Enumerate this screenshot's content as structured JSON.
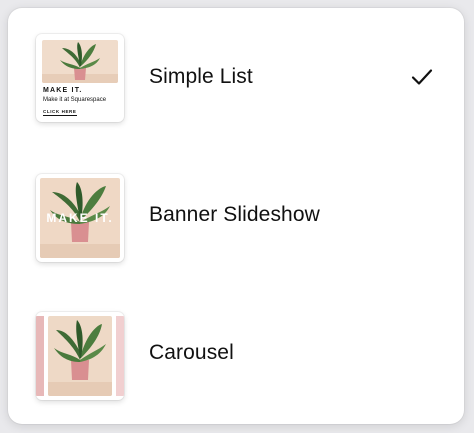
{
  "options": [
    {
      "label": "Simple List",
      "selected": true,
      "thumbnail": {
        "title": "MAKE IT.",
        "subtitle": "Make it at Squarespace",
        "link": "CLICK HERE"
      }
    },
    {
      "label": "Banner Slideshow",
      "selected": false,
      "thumbnail": {
        "title": "MAKE IT."
      }
    },
    {
      "label": "Carousel",
      "selected": false
    }
  ],
  "icons": {
    "check": "check-icon"
  },
  "colors": {
    "text": "#111111",
    "panel": "#ffffff",
    "plant_pot": "#d98f91",
    "background_peach": "#f0dccb"
  }
}
